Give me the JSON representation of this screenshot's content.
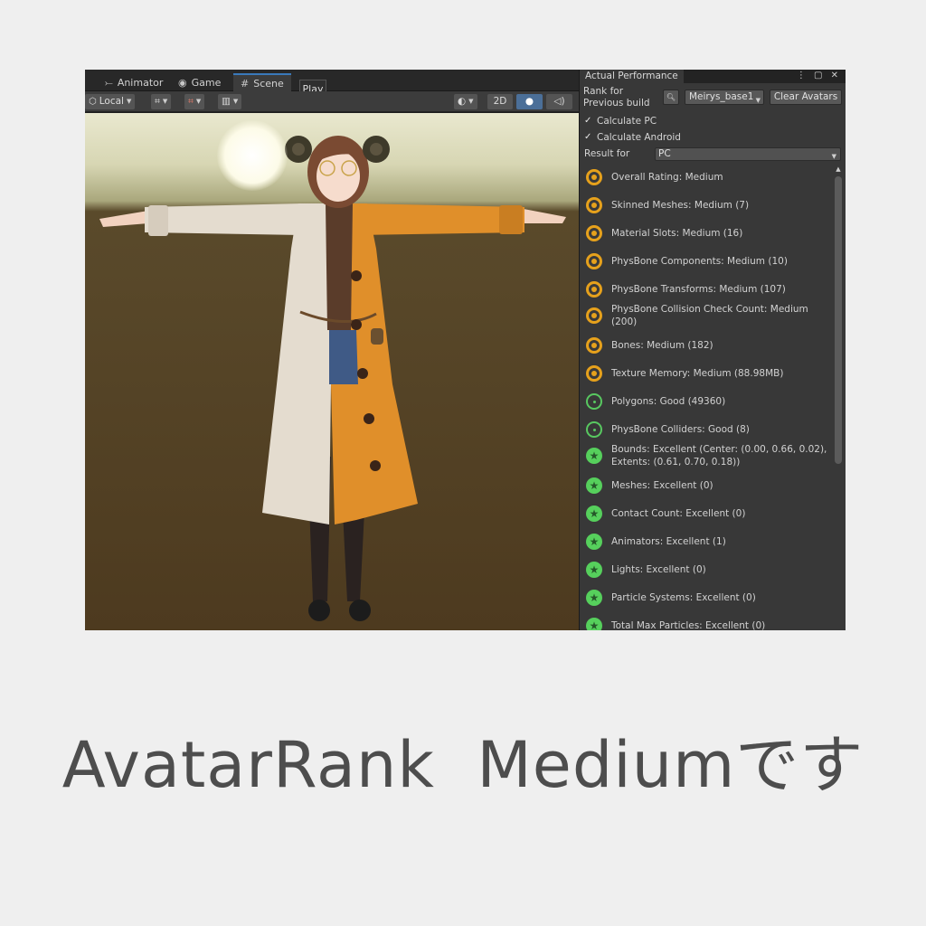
{
  "scene": {
    "tabs": [
      {
        "icon": "animator-icon",
        "glyph": "⤚",
        "label": "Animator"
      },
      {
        "icon": "gamepad-icon",
        "glyph": "◉",
        "label": "Game"
      },
      {
        "icon": "grid-icon",
        "glyph": "#",
        "label": "Scene"
      }
    ],
    "play_label": "Play",
    "toolbar": {
      "pivot_label": "Local",
      "view_2d_label": "2D"
    },
    "colors": {
      "sky_top": "#e9e8cf",
      "ground": "#4d3a1f",
      "coat_white": "#e4dccf",
      "coat_orange": "#e08f2a"
    }
  },
  "panel": {
    "tab_title": "Actual Performance",
    "rank_label_line1": "Rank for",
    "rank_label_line2": "Previous build",
    "avatar_select": "Meirys_base1",
    "clear_avatars": "Clear Avatars",
    "calc_pc": "Calculate PC",
    "calc_android": "Calculate Android",
    "result_for_label": "Result for",
    "result_for_value": "PC",
    "ratings": [
      {
        "level": "medium",
        "line1": "Overall Rating: Medium"
      },
      {
        "level": "medium",
        "line1": "Skinned Meshes: Medium (7)"
      },
      {
        "level": "medium",
        "line1": "Material Slots: Medium (16)"
      },
      {
        "level": "medium",
        "line1": "PhysBone Components: Medium (10)"
      },
      {
        "level": "medium",
        "line1": "PhysBone Transforms: Medium (107)"
      },
      {
        "level": "medium",
        "line1": "PhysBone Collision Check Count: Medium",
        "line2": "(200)"
      },
      {
        "level": "medium",
        "line1": "Bones: Medium (182)"
      },
      {
        "level": "medium",
        "line1": "Texture Memory: Medium (88.98MB)"
      },
      {
        "level": "good",
        "line1": "Polygons: Good (49360)"
      },
      {
        "level": "good",
        "line1": "PhysBone Colliders: Good (8)"
      },
      {
        "level": "excellent",
        "line1": "Bounds: Excellent (Center: (0.00, 0.66, 0.02),",
        "line2": "Extents: (0.61, 0.70, 0.18))"
      },
      {
        "level": "excellent",
        "line1": "Meshes: Excellent (0)"
      },
      {
        "level": "excellent",
        "line1": "Contact Count: Excellent (0)"
      },
      {
        "level": "excellent",
        "line1": "Animators: Excellent (1)"
      },
      {
        "level": "excellent",
        "line1": "Lights: Excellent (0)"
      },
      {
        "level": "excellent",
        "line1": "Particle Systems: Excellent (0)"
      },
      {
        "level": "excellent",
        "line1": "Total Max Particles: Excellent (0)"
      }
    ],
    "colors": {
      "medium": "#e6a11c",
      "good": "#58c860",
      "excellent": "#56d05c"
    }
  },
  "caption": "AvatarRank  Mediumです"
}
